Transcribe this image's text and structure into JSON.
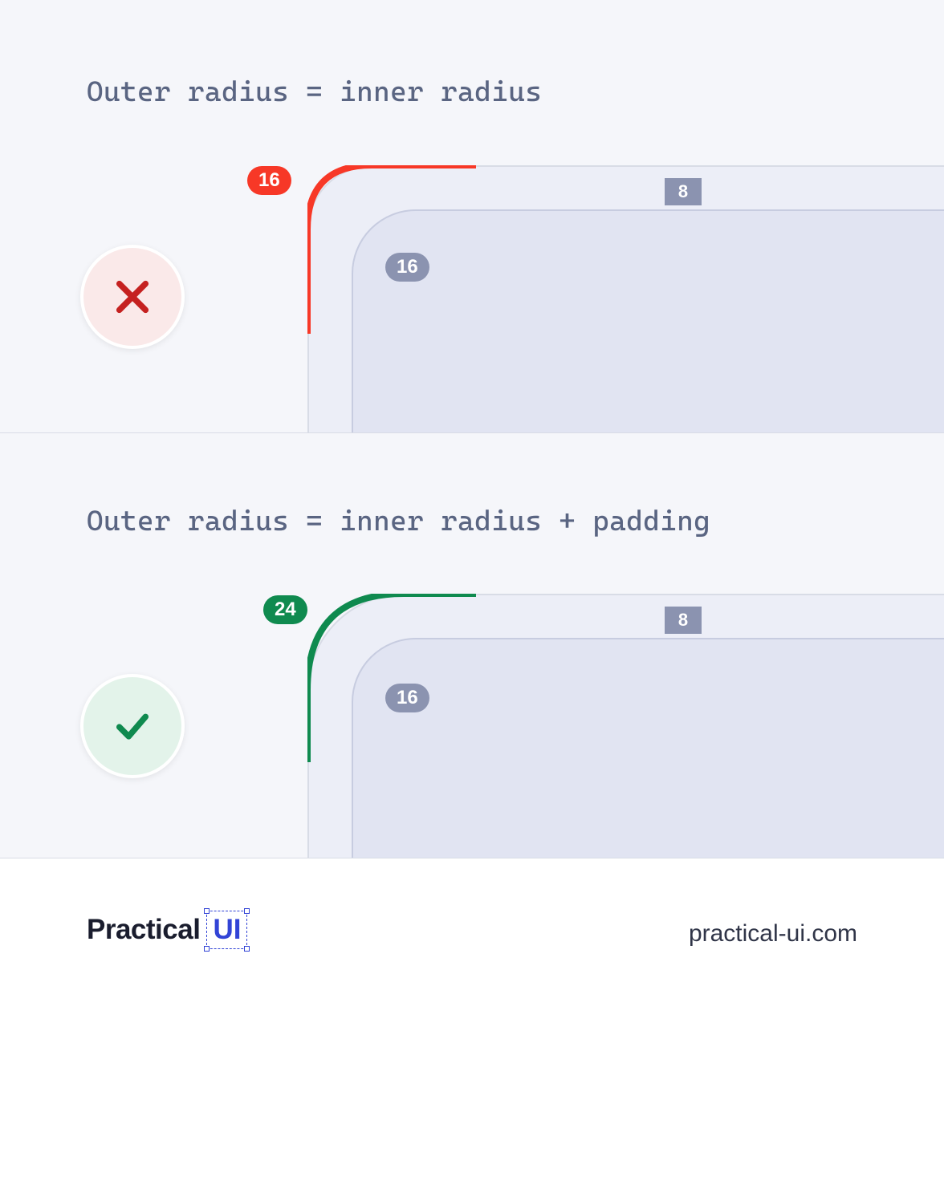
{
  "panels": {
    "bad": {
      "title": "Outer radius = inner radius",
      "outer_radius_label": "16",
      "inner_radius_label": "16",
      "padding_label": "8"
    },
    "good": {
      "title": "Outer radius = inner radius + padding",
      "outer_radius_label": "24",
      "inner_radius_label": "16",
      "padding_label": "8"
    }
  },
  "footer": {
    "brand_word": "Practical",
    "brand_box": "UI",
    "url": "practical-ui.com"
  },
  "colors": {
    "bad": "#f73827",
    "good": "#0f8a4f",
    "gray": "#8b93b0"
  }
}
